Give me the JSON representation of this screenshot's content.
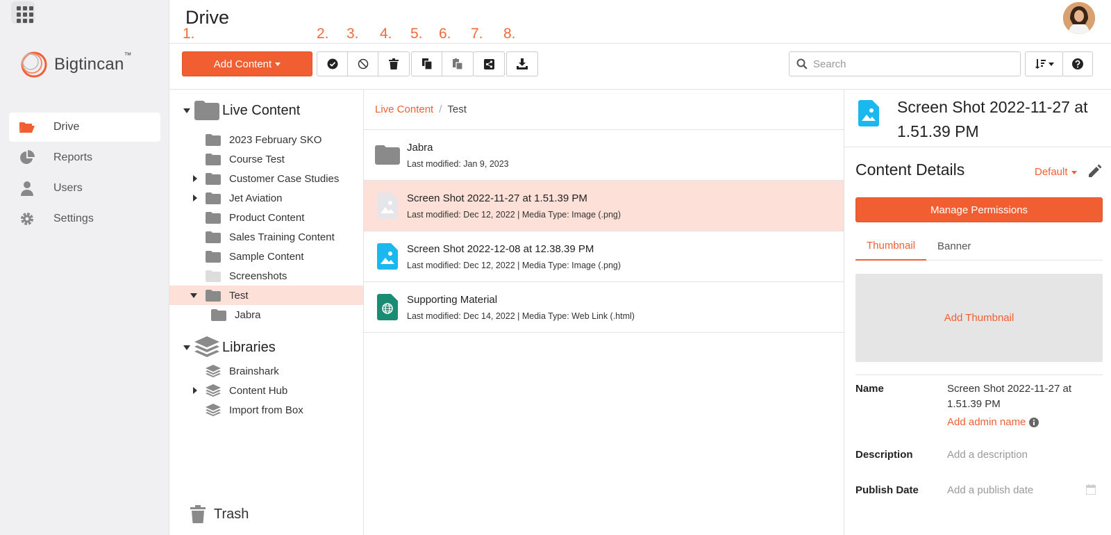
{
  "header": {
    "title": "Drive"
  },
  "steps": [
    "1.",
    "2.",
    "3.",
    "4.",
    "5.",
    "6.",
    "7.",
    "8."
  ],
  "logo": {
    "text": "Bigtincan",
    "tm": "™"
  },
  "nav": {
    "items": [
      {
        "label": "Drive",
        "icon": "folder-open-icon",
        "active": true
      },
      {
        "label": "Reports",
        "icon": "pie-chart-icon"
      },
      {
        "label": "Users",
        "icon": "user-icon"
      },
      {
        "label": "Settings",
        "icon": "gear-icon"
      }
    ]
  },
  "toolbar": {
    "add_content_label": "Add Content",
    "search_placeholder": "Search"
  },
  "tree": {
    "live_content": {
      "label": "Live Content",
      "items": [
        {
          "label": "2023 February SKO",
          "expandable": false
        },
        {
          "label": "Course Test",
          "expandable": false
        },
        {
          "label": "Customer Case Studies",
          "expandable": true
        },
        {
          "label": "Jet Aviation",
          "expandable": true
        },
        {
          "label": "Product Content",
          "expandable": false
        },
        {
          "label": "Sales Training Content",
          "expandable": false
        },
        {
          "label": "Sample Content",
          "expandable": false
        },
        {
          "label": "Screenshots",
          "expandable": false,
          "light": true
        },
        {
          "label": "Test",
          "expanded": true,
          "selected": true
        },
        {
          "label": "Jabra",
          "child": true
        }
      ]
    },
    "libraries": {
      "label": "Libraries",
      "items": [
        {
          "label": "Brainshark",
          "expandable": false
        },
        {
          "label": "Content Hub",
          "expandable": true
        },
        {
          "label": "Import from Box",
          "expandable": false
        }
      ]
    },
    "trash_label": "Trash"
  },
  "breadcrumb": {
    "root": "Live Content",
    "separator": "/",
    "current": "Test"
  },
  "files": [
    {
      "name": "Jabra",
      "meta": "Last modified: Jan 9, 2023",
      "icon": "folder-icon"
    },
    {
      "name": "Screen Shot 2022-11-27 at 1.51.39 PM",
      "meta": "Last modified: Dec 12, 2022 | Media Type: Image (.png)",
      "icon": "image-file-icon-gray",
      "selected": true
    },
    {
      "name": "Screen Shot 2022-12-08 at 12.38.39 PM",
      "meta": "Last modified: Dec 12, 2022 | Media Type: Image (.png)",
      "icon": "image-file-icon"
    },
    {
      "name": "Supporting Material",
      "meta": "Last modified: Dec 14, 2022 | Media Type: Web Link (.html)",
      "icon": "web-link-icon"
    }
  ],
  "detail": {
    "title": "Screen Shot 2022-11-27 at 1.51.39 PM",
    "section_title": "Content Details",
    "default_label": "Default",
    "manage_permissions": "Manage Permissions",
    "tabs": [
      "Thumbnail",
      "Banner"
    ],
    "add_thumbnail": "Add Thumbnail",
    "fields": {
      "name_label": "Name",
      "name_value": "Screen Shot 2022-11-27 at 1.51.39 PM",
      "add_admin_name": "Add admin name",
      "description_label": "Description",
      "description_placeholder": "Add a description",
      "publish_label": "Publish Date",
      "publish_placeholder": "Add a publish date"
    }
  },
  "colors": {
    "accent": "#f15e32",
    "selected_bg": "#fde0d7",
    "sidebar_bg": "#f0f0f2"
  }
}
